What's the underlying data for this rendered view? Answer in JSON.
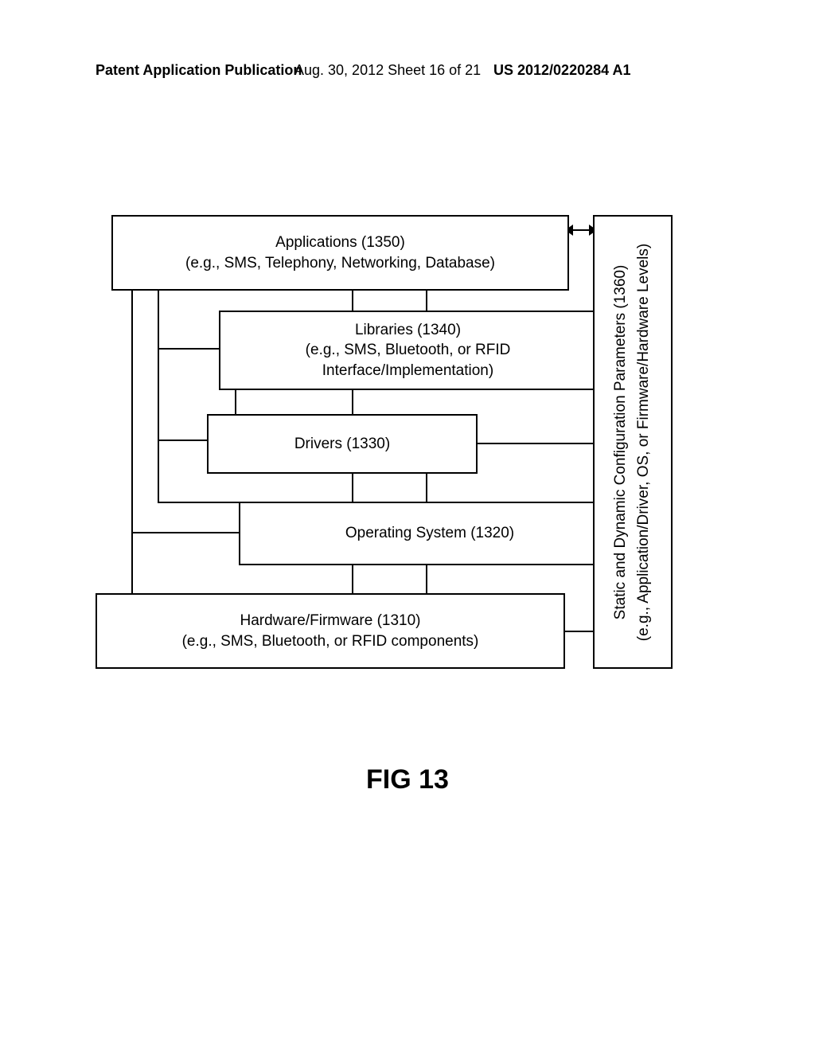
{
  "header": {
    "left": "Patent Application Publication",
    "mid": "Aug. 30, 2012  Sheet 16 of 21",
    "right": "US 2012/0220284 A1"
  },
  "boxes": {
    "applications": {
      "title": "Applications (1350)",
      "sub": "(e.g., SMS, Telephony, Networking, Database)"
    },
    "libraries": {
      "title": "Libraries (1340)",
      "sub": "(e.g., SMS, Bluetooth, or RFID\nInterface/Implementation)"
    },
    "drivers": {
      "title": "Drivers (1330)",
      "sub": ""
    },
    "os": {
      "title": "Operating System (1320)",
      "sub": ""
    },
    "hardware": {
      "title": "Hardware/Firmware (1310)",
      "sub": "(e.g., SMS, Bluetooth, or RFID components)"
    },
    "sidebar": {
      "line1": "Static and Dynamic Configuration Parameters (1360)",
      "line2": "(e.g., Application/Driver, OS, or Firmware/Hardware Levels)"
    }
  },
  "figure_label": "FIG 13"
}
